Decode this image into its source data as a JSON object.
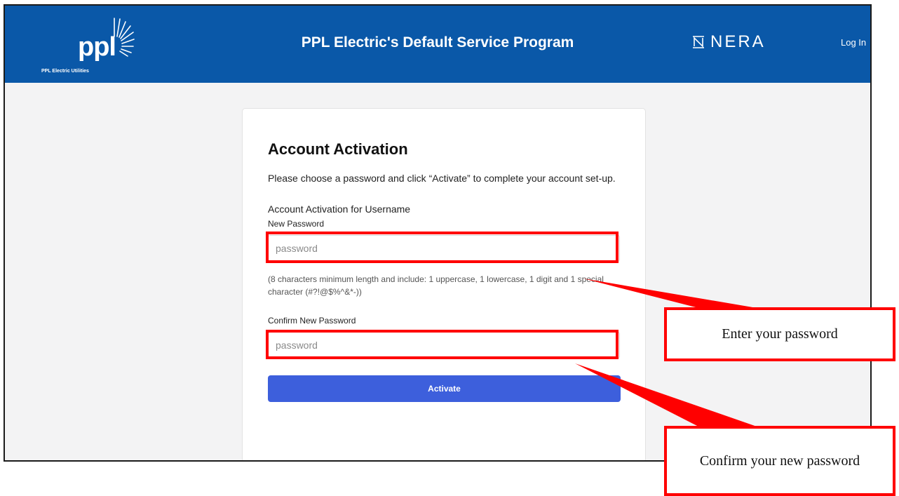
{
  "header": {
    "logo": {
      "word": "ppl",
      "subtitle": "PPL Electric Utilities"
    },
    "title": "PPL Electric's Default Service Program",
    "partner_logo": "NERA",
    "login_label": "Log In"
  },
  "card": {
    "title": "Account Activation",
    "description": "Please choose a password and click “Activate” to complete your account set-up.",
    "username_line": "Account Activation for Username",
    "new_password": {
      "label": "New Password",
      "placeholder": "password"
    },
    "hint": "(8 characters minimum length and include: 1 uppercase, 1 lowercase, 1 digit and 1 special character (#?!@$%^&*-))",
    "confirm_password": {
      "label": "Confirm New Password",
      "placeholder": "password"
    },
    "activate_label": "Activate"
  },
  "annotations": {
    "callout_1": "Enter your password",
    "callout_2": "Confirm your new password"
  },
  "colors": {
    "header_bg": "#0a58a8",
    "button_bg": "#3d5fdc",
    "highlight": "#ff0000"
  }
}
